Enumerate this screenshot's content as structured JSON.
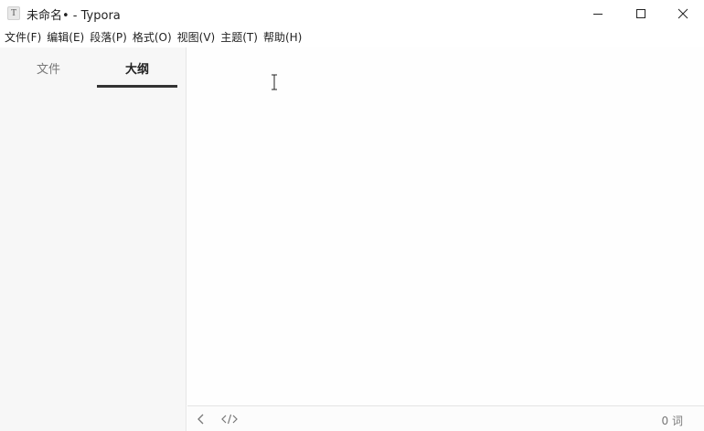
{
  "window": {
    "app_icon_letter": "T",
    "title": "未命名• - Typora"
  },
  "window_controls": {
    "minimize_icon": "minimize-icon",
    "maximize_icon": "maximize-icon",
    "close_icon": "close-icon"
  },
  "menubar": {
    "items": [
      {
        "label": "文件(F)"
      },
      {
        "label": "编辑(E)"
      },
      {
        "label": "段落(P)"
      },
      {
        "label": "格式(O)"
      },
      {
        "label": "视图(V)"
      },
      {
        "label": "主题(T)"
      },
      {
        "label": "帮助(H)"
      }
    ]
  },
  "sidebar": {
    "tabs": [
      {
        "label": "文件",
        "active": false
      },
      {
        "label": "大纲",
        "active": true
      }
    ]
  },
  "editor": {
    "cursor_icon": "text-cursor-icon"
  },
  "footer": {
    "back_icon": "chevron-left-icon",
    "source_icon": "code-source-icon",
    "word_count": "0 词"
  }
}
